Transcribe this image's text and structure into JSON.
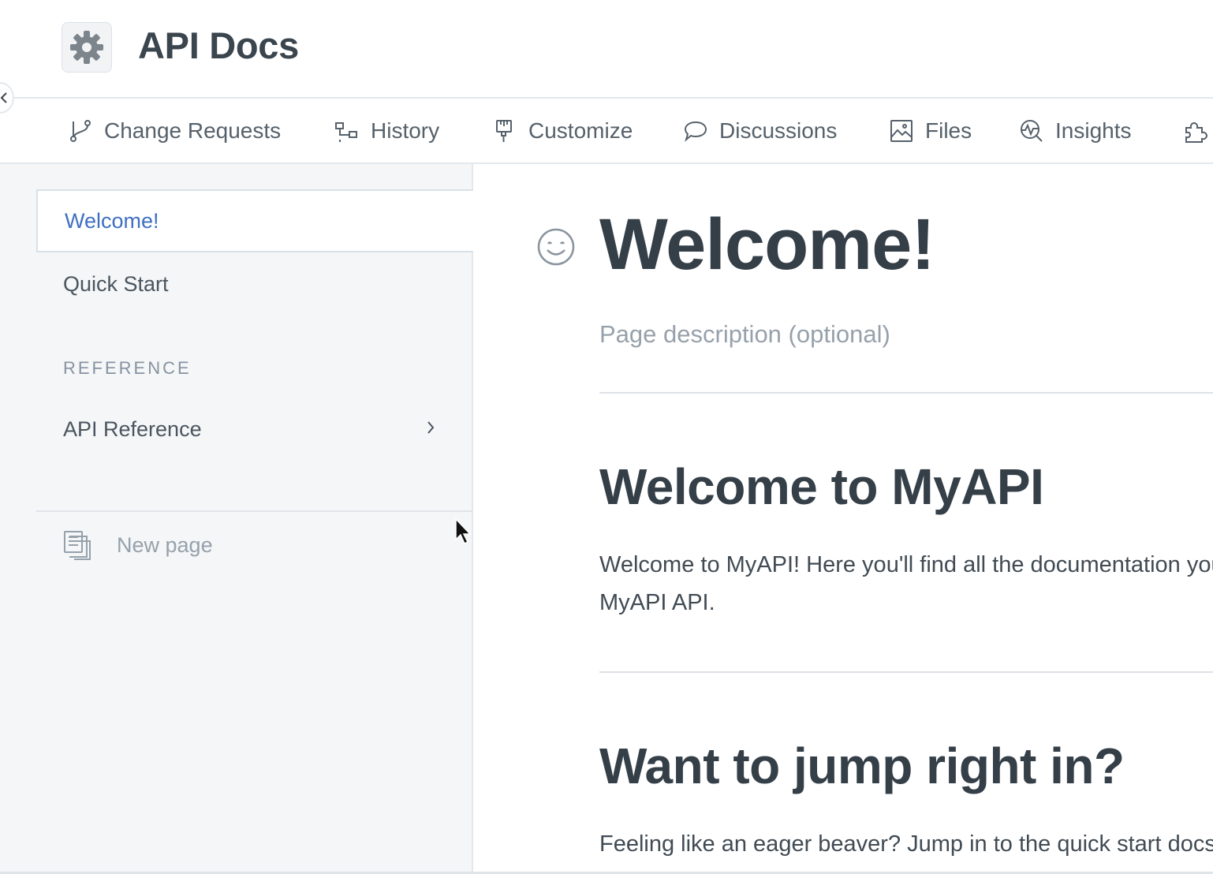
{
  "header": {
    "logo_icon": "gear-icon",
    "title": "API Docs"
  },
  "nav": {
    "items": [
      {
        "label": "Change Requests",
        "icon": "branch-icon"
      },
      {
        "label": "History",
        "icon": "history-icon"
      },
      {
        "label": "Customize",
        "icon": "paintbrush-icon"
      },
      {
        "label": "Discussions",
        "icon": "speech-bubble-icon"
      },
      {
        "label": "Files",
        "icon": "image-file-icon"
      },
      {
        "label": "Insights",
        "icon": "insights-icon"
      },
      {
        "label": "",
        "icon": "puzzle-icon"
      }
    ]
  },
  "sidebar": {
    "items": [
      {
        "label": "Welcome!",
        "active": true
      },
      {
        "label": "Quick Start",
        "active": false
      }
    ],
    "section_title": "REFERENCE",
    "reference_items": [
      {
        "label": "API Reference"
      }
    ],
    "new_page_label": "New page"
  },
  "main": {
    "title": "Welcome!",
    "description_placeholder": "Page description (optional)",
    "sections": [
      {
        "heading": "Welcome to MyAPI",
        "paragraph_line1": "Welcome to MyAPI! Here you'll find all the documentation you need to get up and running with the",
        "paragraph_line2": "MyAPI API."
      },
      {
        "heading": "Want to jump right in?",
        "paragraph_line1": "Feeling like an eager beaver? Jump in to the quick start docs and get making your first request:"
      }
    ]
  },
  "colors": {
    "accent": "#3f6fc2",
    "sidebar_bg": "#f4f6f8",
    "text": "#3b454e",
    "muted": "#97a1ab"
  }
}
